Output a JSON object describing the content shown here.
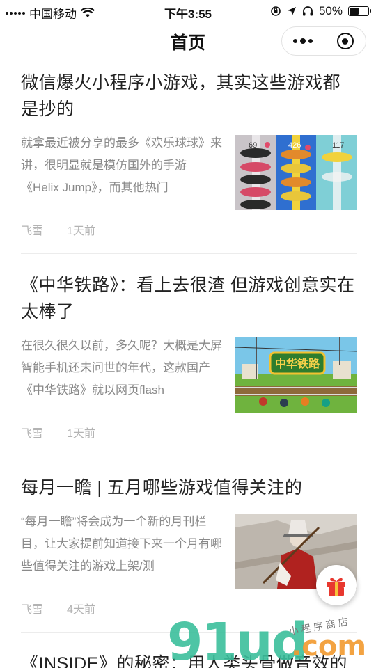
{
  "status_bar": {
    "carrier": "中国移动",
    "time": "下午3:55",
    "battery_text": "50%",
    "battery_level": 0.5
  },
  "nav": {
    "title": "首页",
    "more_icon": "more-dots-icon",
    "close_icon": "target-icon"
  },
  "articles": [
    {
      "title": "微信爆火小程序小游戏，其实这些游戏都是抄的",
      "summary": "就拿最近被分享的最多《欢乐球球》来讲，很明显就是模仿国外的手游《Helix Jump》，而其他热门",
      "author": "飞雪",
      "time": "1天前",
      "thumb_numbers": [
        "69",
        "426",
        "117"
      ]
    },
    {
      "title": "《中华铁路》：看上去很渣 但游戏创意实在太棒了",
      "summary": "在很久很久以前，多久呢？大概是大屏智能手机还未问世的年代，这款国产《中华铁路》就以网页flash",
      "author": "飞雪",
      "time": "1天前",
      "thumb_logo": "中华铁路"
    },
    {
      "title": "每月一瞻 | 五月哪些游戏值得关注的",
      "summary": "“每月一瞻”将会成为一个新的月刊栏目，让大家提前知道接下来一个月有哪些值得关注的游戏上架/测",
      "author": "飞雪",
      "time": "4天前"
    },
    {
      "title": "《INSIDE》的秘密：用人类头骨做音效的"
    }
  ],
  "floating_button": {
    "icon": "gift-icon"
  },
  "watermark": {
    "main": "91ud",
    "com": ".com",
    "small": "小程序商店"
  },
  "colors": {
    "title": "#222222",
    "summary": "#8a8a8a",
    "meta": "#b3b3b3",
    "watermark_green": "#3bbf9c",
    "watermark_orange": "#f29a2e",
    "gift_red": "#e8382f"
  }
}
